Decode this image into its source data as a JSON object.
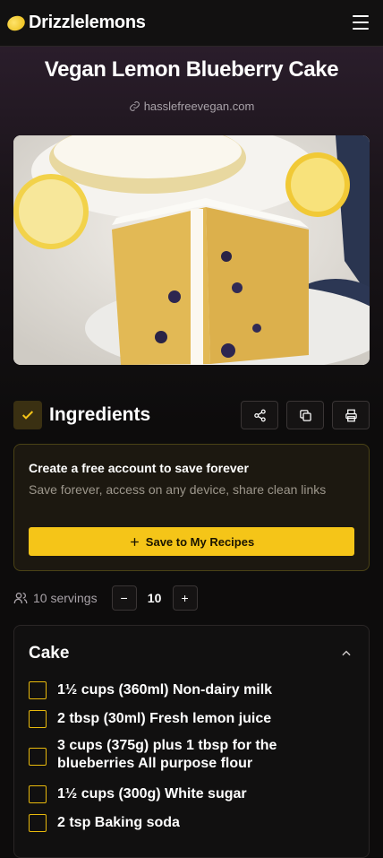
{
  "header": {
    "brand": "Drizzlelemons",
    "menu_icon": "hamburger-menu-icon",
    "logo_icon": "lemon-icon"
  },
  "recipe": {
    "title": "Vegan Lemon Blueberry Cake",
    "source": "hasslefreevegan.com",
    "photo_alt": "Slice of lemon blueberry layer cake on a plate with lemon halves"
  },
  "ingredients": {
    "heading": "Ingredients",
    "tools": [
      "share-icon",
      "copy-icon",
      "print-icon"
    ]
  },
  "promo": {
    "title": "Create a free account to save forever",
    "body": "Save forever, access on any device, share clean links",
    "button": "Save to My Recipes"
  },
  "servings": {
    "label": "10 servings",
    "count": "10",
    "minus": "−",
    "plus": "+"
  },
  "section": {
    "title": "Cake",
    "items": [
      "1½ cups (360ml) Non-dairy milk",
      "2 tbsp (30ml) Fresh lemon juice",
      "3 cups (375g) plus 1 tbsp for the blueberries All purpose flour",
      "1½ cups (300g) White sugar",
      "2 tsp Baking soda"
    ]
  },
  "colors": {
    "accent": "#f5c518",
    "background": "#0d0c0c"
  }
}
